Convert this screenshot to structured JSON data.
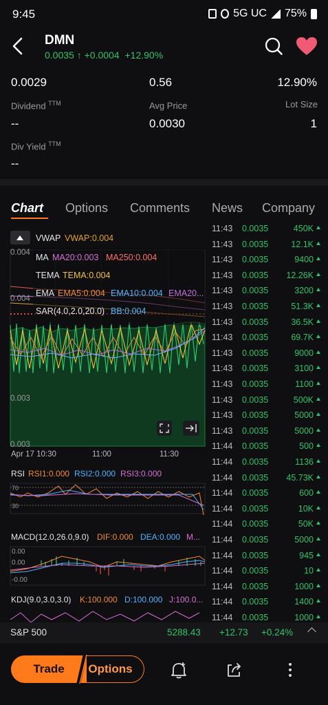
{
  "status": {
    "time": "9:45",
    "network": "5G UC",
    "battery": "75%"
  },
  "header": {
    "title": "DMN",
    "price": "0.0035",
    "change": "+0.0004",
    "change_pct": "+12.90%"
  },
  "stats": {
    "v1": "0.0029",
    "v2": "0.56",
    "v3": "12.90%",
    "dividend_label": "Dividend",
    "dividend_sup": "TTM",
    "dividend_value": "--",
    "avg_price_label": "Avg Price",
    "avg_price_value": "0.0030",
    "lot_size_label": "Lot Size",
    "lot_size_value": "1",
    "div_yield_label": "Div Yield",
    "div_yield_sup": "TTM",
    "div_yield_value": "--"
  },
  "tabs": [
    "Chart",
    "Options",
    "Comments",
    "News",
    "Company"
  ],
  "chart": {
    "vwap": "VWAP",
    "vwap_val": "VWAP:0.004",
    "ma": "MA",
    "ma20": "MA20:0.003",
    "ma250": "MA250:0.004",
    "tema": "TEMA",
    "tema_val": "TEMA:0.004",
    "ema": "EMA",
    "ema5": "EMA5:0.004",
    "ema10": "EMA10:0.004",
    "ema20": "EMA20...",
    "sar": "SAR(4.0,2.0,20.0)",
    "bb": "BB:0.004",
    "y_top": "0.004",
    "y_mid_label": "0.004",
    "y_003": "0.003",
    "y_bot": "0.003",
    "x_labels": [
      "Apr 17 10:30",
      "11:00",
      "11:30"
    ],
    "rsi": "RSI",
    "rsi1": "RSI1:0.000",
    "rsi2": "RSI2:0.000",
    "rsi3": "RSI3:0.000",
    "rsi_70": "70",
    "rsi_30": "30",
    "macd": "MACD(12.0,26.0,9.0)",
    "dif": "DIF:0.000",
    "dea": "DEA:0.000",
    "macd_m": "M...",
    "macd_y1": "0.00",
    "macd_y2": "0.00",
    "macd_y3": "-0.00",
    "kdj": "KDJ(9.0,3.0,3.0)",
    "k": "K:100.000",
    "d": "D:100.000",
    "j": "J:100.0..."
  },
  "trades": [
    {
      "time": "11:43",
      "price": "0.0035",
      "vol": "450K"
    },
    {
      "time": "11:43",
      "price": "0.0035",
      "vol": "12.1K"
    },
    {
      "time": "11:43",
      "price": "0.0035",
      "vol": "9400"
    },
    {
      "time": "11:43",
      "price": "0.0035",
      "vol": "12.26K"
    },
    {
      "time": "11:43",
      "price": "0.0035",
      "vol": "3200"
    },
    {
      "time": "11:43",
      "price": "0.0035",
      "vol": "51.3K"
    },
    {
      "time": "11:43",
      "price": "0.0035",
      "vol": "36.5K"
    },
    {
      "time": "11:43",
      "price": "0.0035",
      "vol": "69.7K"
    },
    {
      "time": "11:43",
      "price": "0.0035",
      "vol": "9000"
    },
    {
      "time": "11:43",
      "price": "0.0035",
      "vol": "3100"
    },
    {
      "time": "11:43",
      "price": "0.0035",
      "vol": "1100"
    },
    {
      "time": "11:43",
      "price": "0.0035",
      "vol": "500K"
    },
    {
      "time": "11:43",
      "price": "0.0035",
      "vol": "5000"
    },
    {
      "time": "11:43",
      "price": "0.0035",
      "vol": "5000"
    },
    {
      "time": "11:44",
      "price": "0.0035",
      "vol": "500"
    },
    {
      "time": "11:44",
      "price": "0.0035",
      "vol": "1136"
    },
    {
      "time": "11:44",
      "price": "0.0035",
      "vol": "45.73K"
    },
    {
      "time": "11:44",
      "price": "0.0035",
      "vol": "600"
    },
    {
      "time": "11:44",
      "price": "0.0035",
      "vol": "10K"
    },
    {
      "time": "11:44",
      "price": "0.0035",
      "vol": "50K"
    },
    {
      "time": "11:44",
      "price": "0.0035",
      "vol": "5000"
    },
    {
      "time": "11:44",
      "price": "0.0035",
      "vol": "945"
    },
    {
      "time": "11:44",
      "price": "0.0035",
      "vol": "10"
    },
    {
      "time": "11:44",
      "price": "0.0035",
      "vol": "1000"
    },
    {
      "time": "11:44",
      "price": "0.0035",
      "vol": "1400"
    },
    {
      "time": "11:44",
      "price": "0.0035",
      "vol": "1000"
    }
  ],
  "index": {
    "name": "S&P 500",
    "value": "5288.43",
    "change": "+12.73",
    "pct": "+0.24%"
  },
  "bottom": {
    "trade": "Trade",
    "options": "Options"
  },
  "colors": {
    "up": "#2fc36b",
    "accent": "#ff7a1a",
    "down": "#e84545"
  }
}
